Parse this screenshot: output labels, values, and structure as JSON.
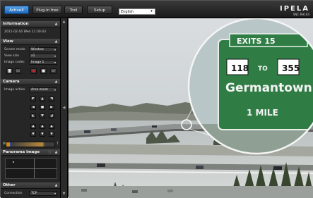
{
  "tabs": [
    {
      "label": "ActiveX",
      "active": true
    },
    {
      "label": "Plug-in free",
      "active": false
    },
    {
      "label": "Tool",
      "active": false
    },
    {
      "label": "Setup",
      "active": false
    }
  ],
  "language": {
    "value": "English"
  },
  "brand": {
    "logo": "IPELA",
    "model": "SNC-RH164"
  },
  "information": {
    "title": "Information",
    "datetime": "2011-02-16 Wed 11:30:43"
  },
  "view": {
    "title": "View",
    "screen_mode_label": "Screen mode",
    "screen_mode_value": "Window",
    "view_size_label": "View size",
    "view_size_value": "x1",
    "image_codec_label": "Image codec",
    "image_codec_value": "Image 1"
  },
  "camera": {
    "title": "Camera",
    "image_action_label": "Image action",
    "image_action_value": "Area zoom",
    "zoom_letter_w": "W",
    "zoom_letter_t": "T"
  },
  "panorama": {
    "title": "Panorama image"
  },
  "other": {
    "title": "Other",
    "connection_label": "Connection",
    "connection_value": "TCP"
  },
  "sign": {
    "exit_text": "EXITS 15",
    "route_a": "118",
    "to_text": "TO",
    "route_b": "355",
    "place": "Germantown",
    "distance": "1 MILE"
  },
  "colors": {
    "active_tab": "#1d66b8",
    "sign_green": "#2f7d45",
    "record_button": "#d41a1a"
  },
  "icons": [
    "chevron-down-icon",
    "snapshot-icon",
    "folder-icon",
    "record-icon",
    "stop-icon",
    "grid-icon",
    "arrow-up-icon",
    "arrow-down-icon",
    "arrow-left-icon",
    "arrow-right-icon",
    "home-icon",
    "help-icon",
    "collapse-icon"
  ]
}
